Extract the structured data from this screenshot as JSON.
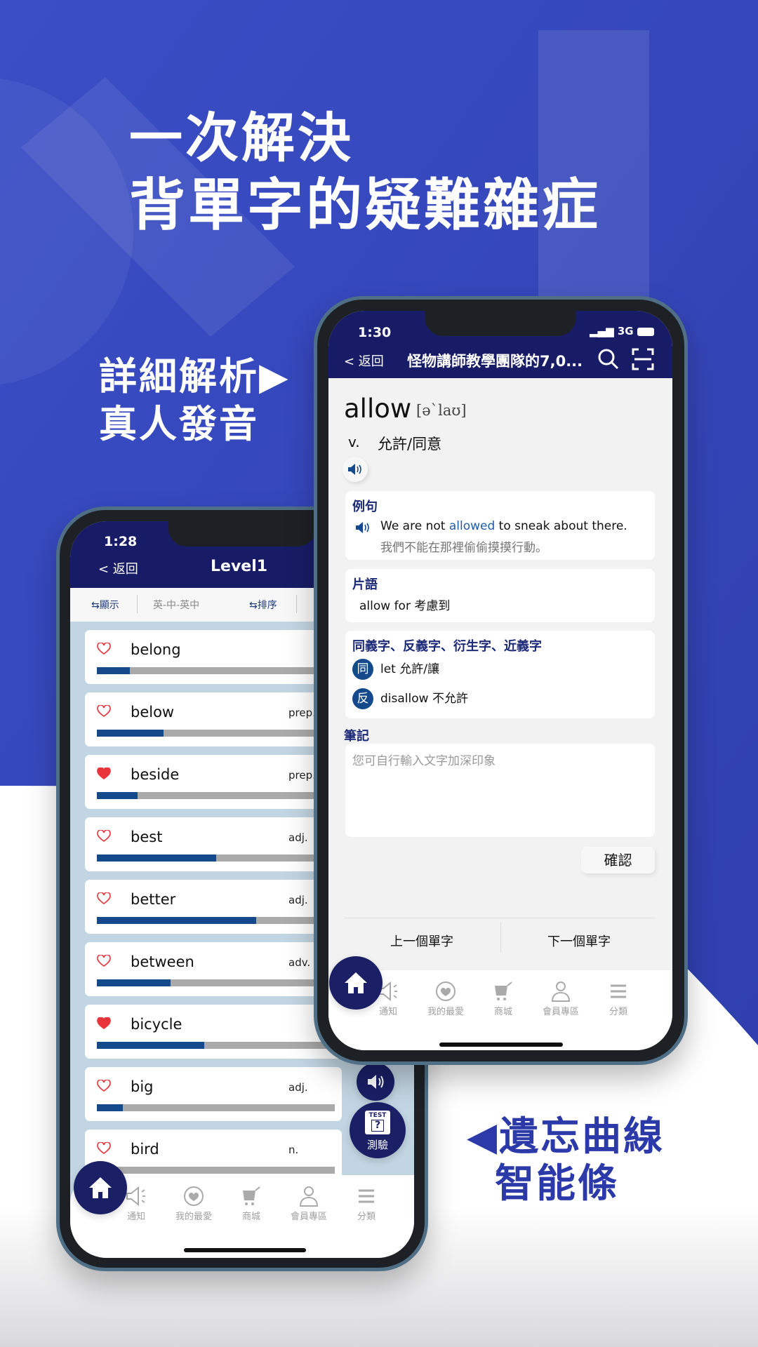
{
  "colors": {
    "background_blue": "#3446c0",
    "navy": "#181c66",
    "accent_blue": "#144a8c",
    "heart_red": "#e8343a"
  },
  "headline": {
    "line1": "一次解決",
    "line2": "背單字的疑難雜症"
  },
  "callout_left": {
    "line1": "詳細解析▶",
    "line2": "真人發音"
  },
  "callout_right": {
    "line1": "◀遺忘曲線",
    "line2": "智能條"
  },
  "back_phone": {
    "time": "1:28",
    "back_label": "< 返回",
    "title": "Level1",
    "toolbar": {
      "display_label": "顯示",
      "display_value": "英-中-英中",
      "sort_label": "排序"
    },
    "words": [
      {
        "word": "belong",
        "pos": "",
        "favorite": false,
        "progress": 0.14
      },
      {
        "word": "below",
        "pos": "prep.",
        "favorite": false,
        "progress": 0.28
      },
      {
        "word": "beside",
        "pos": "prep.",
        "favorite": true,
        "progress": 0.17
      },
      {
        "word": "best",
        "pos": "adj.",
        "favorite": false,
        "progress": 0.5
      },
      {
        "word": "better",
        "pos": "adj.",
        "favorite": false,
        "progress": 0.67
      },
      {
        "word": "between",
        "pos": "adv. prep.",
        "favorite": false,
        "progress": 0.31
      },
      {
        "word": "bicycle",
        "pos": "",
        "favorite": true,
        "progress": 0.45
      },
      {
        "word": "big",
        "pos": "adj.",
        "favorite": false,
        "progress": 0.11
      },
      {
        "word": "bird",
        "pos": "n.",
        "favorite": false,
        "progress": 0.0
      }
    ],
    "test_label": "測驗",
    "test_badge": "TEST",
    "tabs": [
      "通知",
      "我的最愛",
      "商城",
      "會員專區",
      "分類"
    ]
  },
  "front_phone": {
    "time": "1:30",
    "network": "3G",
    "back_label": "< 返回",
    "title": "怪物講師教學團隊的7,0...",
    "word": "allow",
    "phonetic": "[ə`laʊ]",
    "pos": "v.",
    "meaning": "允許/同意",
    "example": {
      "heading": "例句",
      "before": "We are not ",
      "highlight": "allowed",
      "after": " to sneak about there.",
      "translation": "我們不能在那裡偷偷摸摸行動。"
    },
    "phrase": {
      "heading": "片語",
      "text": "allow for 考慮到"
    },
    "related": {
      "heading": "同義字、反義字、衍生字、近義字",
      "items": [
        {
          "badge": "同",
          "text": "let 允許/讓"
        },
        {
          "badge": "反",
          "text": "disallow 不允許"
        }
      ]
    },
    "notes": {
      "heading": "筆記",
      "placeholder": "您可自行輸入文字加深印象"
    },
    "confirm_label": "確認",
    "prev_label": "上一個單字",
    "next_label": "下一個單字",
    "tabs": [
      "通知",
      "我的最愛",
      "商城",
      "會員專區",
      "分類"
    ]
  }
}
